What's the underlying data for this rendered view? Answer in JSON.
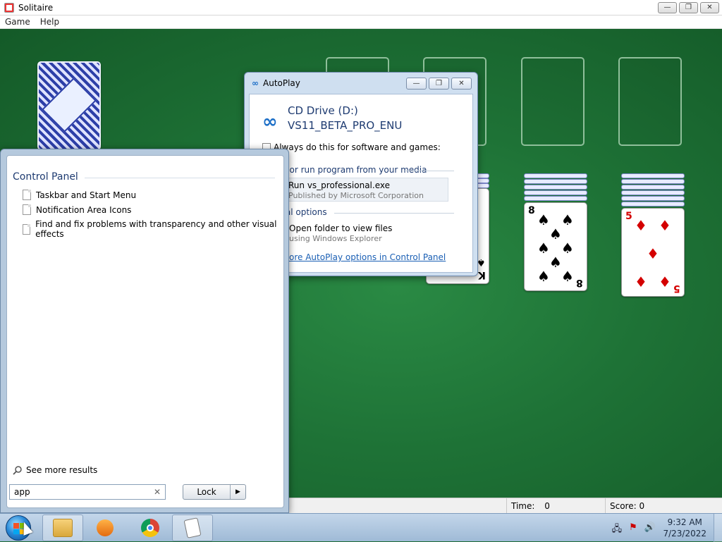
{
  "window": {
    "title": "Solitaire",
    "menu": [
      "Game",
      "Help"
    ],
    "controls": {
      "minimize": "—",
      "restore": "❐",
      "close": "✕"
    }
  },
  "game": {
    "stock": "card-back",
    "foundations": [
      "empty",
      "empty",
      "empty",
      "empty"
    ],
    "visible_cards": [
      {
        "rank": "K",
        "suit": "♠"
      },
      {
        "rank": "8",
        "suit": "♠"
      },
      {
        "rank": "5",
        "suit": "♦"
      }
    ]
  },
  "status": {
    "time_label": "Time:",
    "time_value": "0",
    "score_label": "Score:",
    "score_value": "0"
  },
  "autoplay": {
    "title": "AutoPlay",
    "drive_name": "CD Drive (D:)",
    "drive_label": "VS11_BETA_PRO_ENU",
    "always_label": "Always do this for software and games:",
    "section_install": "ll or run program from your media",
    "run_main": "Run vs_professional.exe",
    "run_sub": "Published by Microsoft Corporation",
    "section_general": "ral options",
    "open_main": "Open folder to view files",
    "open_sub": "using Windows Explorer",
    "more_link": "ore AutoPlay options in Control Panel"
  },
  "start_menu": {
    "category": "Control Panel",
    "items": [
      "Taskbar and Start Menu",
      "Notification Area Icons",
      "Find and fix problems with transparency and other visual effects"
    ],
    "see_more": "See more results",
    "search_value": "app",
    "clear_icon": "✕",
    "lock_label": "Lock",
    "lock_arrow": "▶"
  },
  "taskbar": {
    "apps": [
      "windows-explorer",
      "media-player",
      "chrome",
      "solitaire"
    ],
    "time": "9:32 AM",
    "date": "7/23/2022"
  }
}
